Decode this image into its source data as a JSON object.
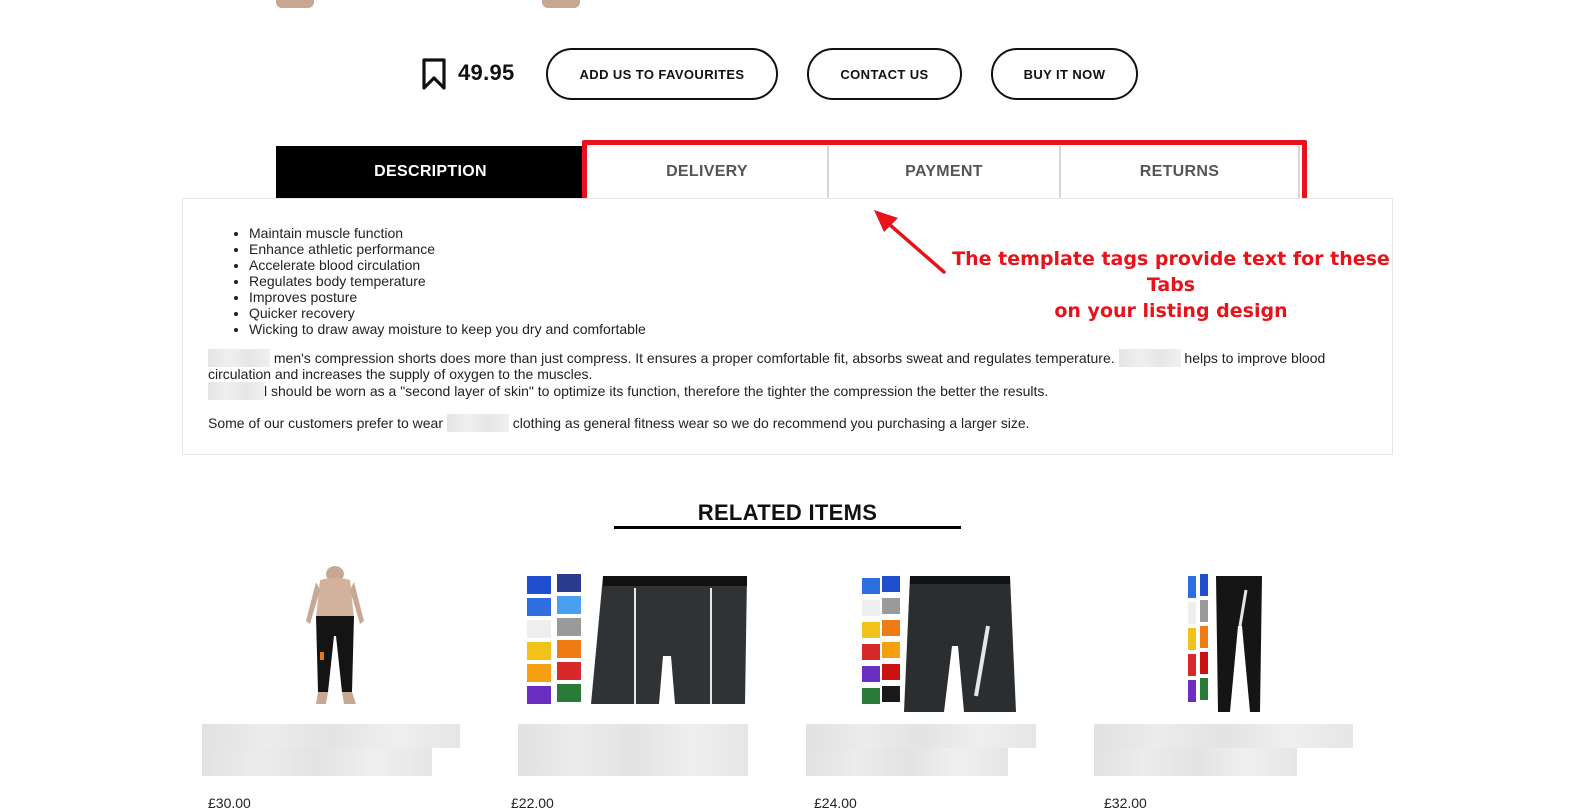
{
  "product": {
    "price": "49.95"
  },
  "actions": {
    "favourites_label": "ADD US TO FAVOURITES",
    "contact_label": "CONTACT US",
    "buy_label": "BUY IT NOW"
  },
  "tabs": [
    {
      "label": "DESCRIPTION",
      "active": true
    },
    {
      "label": "DELIVERY",
      "active": false
    },
    {
      "label": "PAYMENT",
      "active": false
    },
    {
      "label": "RETURNS",
      "active": false
    }
  ],
  "description": {
    "bullets": [
      "Maintain muscle function",
      "Enhance athletic performance",
      "Accelerate blood circulation",
      "Regulates body temperature",
      "Improves posture",
      "Quicker recovery",
      "Wicking to draw away moisture to keep you dry and comfortable"
    ],
    "para1_a": "men's compression shorts does more than just compress. It ensures a proper comfortable fit, absorbs sweat and regulates temperature.",
    "para1_b": "helps to improve blood",
    "para1_c": "circulation and increases the supply of oxygen to the muscles.",
    "para2": "l should be worn as a \"second layer of skin\" to optimize its function, therefore the tighter the compression the better the results.",
    "para3_a": "Some of our customers prefer to wear",
    "para3_b": "clothing as general fitness wear so we do recommend you purchasing a larger size."
  },
  "annotation": {
    "line1": "The template tags provide text for these Tabs",
    "line2": "on your listing design",
    "color": "#e8121a"
  },
  "related": {
    "title": "RELATED ITEMS",
    "items": [
      {
        "price": "£30.00",
        "image": "black-leggings-model-photo"
      },
      {
        "price": "£22.00",
        "image": "compression-shorts-color-swatches"
      },
      {
        "price": "£24.00",
        "image": "long-shorts-color-swatches"
      },
      {
        "price": "£32.00",
        "image": "leggings-color-swatches"
      }
    ]
  },
  "colors": {
    "accent_red": "#e8121a",
    "active_tab_bg": "#000000"
  },
  "icons": {
    "bookmark": "bookmark-icon",
    "arrow": "annotation-arrow-icon"
  }
}
